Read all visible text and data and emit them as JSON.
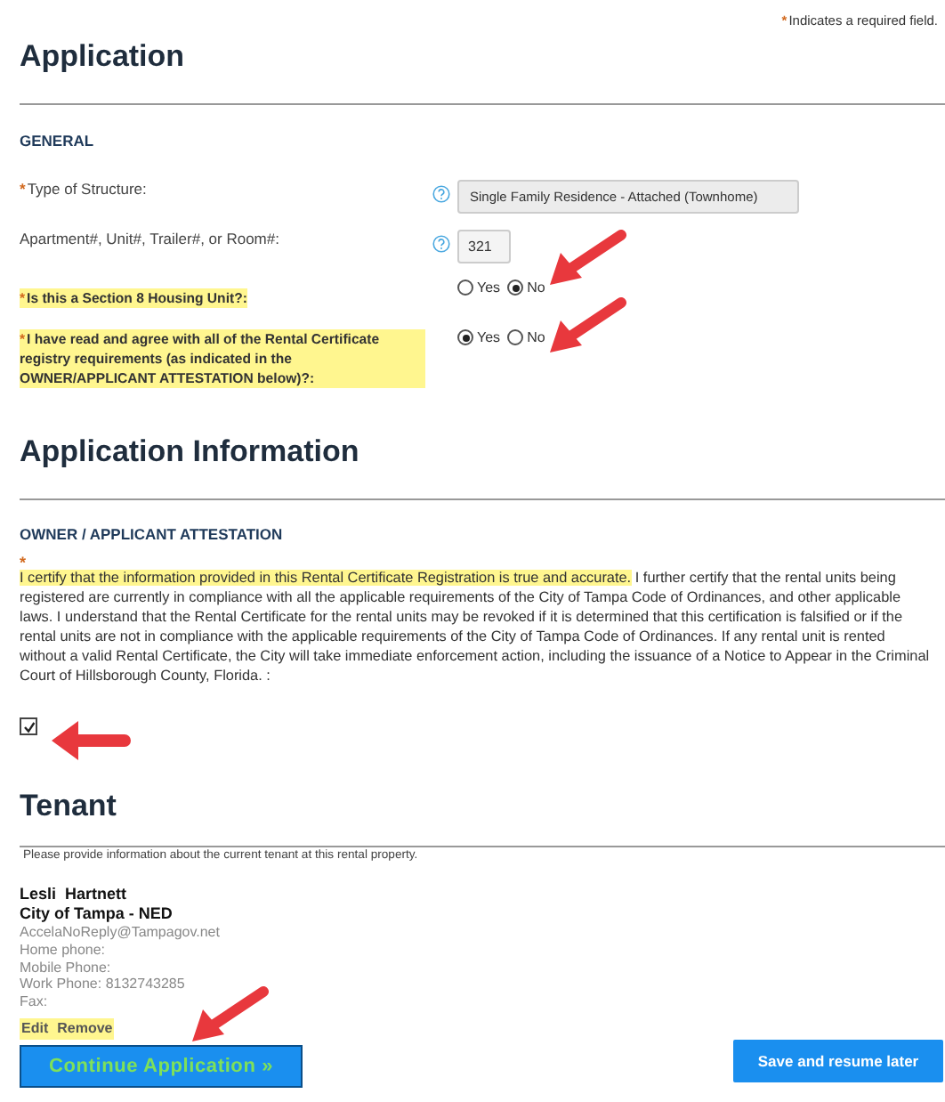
{
  "required_note": {
    "mark": "*",
    "text": "Indicates a required field."
  },
  "application": {
    "title": "Application",
    "subtitle": "GENERAL",
    "fields": [
      {
        "kind": "select",
        "required": true,
        "highlighted": false,
        "help": true,
        "label": "Type of Structure:",
        "value": "Single Family Residence - Attached (Townhome)"
      },
      {
        "kind": "text",
        "required": false,
        "highlighted": false,
        "help": true,
        "label": "Apartment#, Unit#, Trailer#, or Room#:",
        "value": "321"
      },
      {
        "kind": "radio",
        "required": true,
        "highlighted": true,
        "help": false,
        "label": "Is this a Section 8 Housing Unit?:",
        "options": [
          {
            "label": "Yes",
            "selected": false
          },
          {
            "label": "No",
            "selected": true
          }
        ]
      },
      {
        "kind": "radio",
        "required": true,
        "highlighted": true,
        "help": false,
        "label": "I have read and agree with all of the Rental Certificate registry requirements (as indicated in the OWNER/APPLICANT ATTESTATION below)?:",
        "options": [
          {
            "label": "Yes",
            "selected": true
          },
          {
            "label": "No",
            "selected": false
          }
        ]
      }
    ]
  },
  "application_information": {
    "title": "Application Information",
    "subtitle": "OWNER / APPLICANT ATTESTATION",
    "required": true,
    "highlighted_text": "I certify that the information provided in this Rental Certificate Registration is true and accurate.",
    "text": " I further certify that the rental units being registered are currently in compliance with all the applicable requirements of the City of Tampa Code of Ordinances, and other applicable laws. I understand that the Rental Certificate for the rental units may be revoked if it is determined that this certification is falsified or if the rental units are not in compliance with the applicable requirements of the City of Tampa Code of Ordinances. If any rental unit is rented without a valid Rental Certificate, the City will take immediate enforcement action, including the issuance of a Notice to Appear in the Criminal Court of Hillsborough County, Florida. :",
    "checked": true
  },
  "tenant": {
    "title": "Tenant",
    "instructions": "Please provide information about the current tenant at this rental property.",
    "name": "Lesli  Hartnett",
    "organization": "City of Tampa - NED",
    "email": "AccelaNoReply@Tampagov.net",
    "details": [
      "Home phone:",
      "Mobile Phone:",
      "Work Phone: 8132743285",
      "Fax:"
    ],
    "actions": [
      "Edit",
      "Remove"
    ]
  },
  "buttons": [
    {
      "kind": "primary",
      "label": "Continue Application »"
    },
    {
      "kind": "secondary",
      "label": "Save and resume later"
    }
  ]
}
